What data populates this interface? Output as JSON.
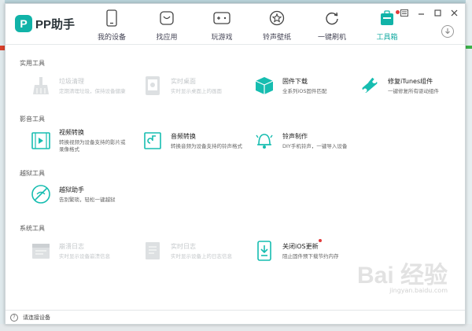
{
  "app": {
    "logo_mark": "P",
    "title": "PP助手"
  },
  "nav": [
    {
      "id": "my-device",
      "label": "我的设备",
      "icon": "phone-icon"
    },
    {
      "id": "find-apps",
      "label": "找应用",
      "icon": "app-bag-icon"
    },
    {
      "id": "games",
      "label": "玩游戏",
      "icon": "gamepad-icon"
    },
    {
      "id": "wallpaper",
      "label": "铃声壁纸",
      "icon": "star-icon"
    },
    {
      "id": "flash",
      "label": "一键刷机",
      "icon": "refresh-icon"
    },
    {
      "id": "toolbox",
      "label": "工具箱",
      "icon": "toolbox-icon",
      "active": true,
      "badge": true
    }
  ],
  "window_controls": [
    "settings-icon",
    "minimize-icon",
    "maximize-icon",
    "close-icon"
  ],
  "sections": [
    {
      "title": "实用工具",
      "tools": [
        {
          "name": "垃圾清理",
          "desc": [
            "定期清理垃圾，保持设备健康"
          ],
          "icon": "broom-icon",
          "disabled": true
        },
        {
          "name": "实时桌面",
          "desc": [
            "实时显示桌面上的画面"
          ],
          "icon": "phone-screen-icon",
          "disabled": true
        },
        {
          "name": "固件下载",
          "desc": [
            "全系列iOS固件匹配"
          ],
          "icon": "firmware-box-icon",
          "disabled": false
        },
        {
          "name": "修复iTunes组件",
          "desc": [
            "一键修复所有驱动组件"
          ],
          "icon": "wrench-icon",
          "disabled": false
        }
      ]
    },
    {
      "title": "影音工具",
      "tools": [
        {
          "name": "视频转换",
          "desc": [
            "转换视频为设备支持的影片或",
            "录像格式"
          ],
          "icon": "video-icon",
          "disabled": false
        },
        {
          "name": "音频转换",
          "desc": [
            "转换音频为设备支持的铃声格式"
          ],
          "icon": "audio-icon",
          "disabled": false
        },
        {
          "name": "铃声制作",
          "desc": [
            "DIY手机铃声，一键导入设备"
          ],
          "icon": "bell-icon",
          "disabled": false
        }
      ]
    },
    {
      "title": "越狱工具",
      "tools": [
        {
          "name": "越狱助手",
          "desc": [
            "告别繁琐，轻松一键越狱"
          ],
          "icon": "jailbreak-icon",
          "disabled": false
        }
      ]
    },
    {
      "title": "系统工具",
      "tools": [
        {
          "name": "崩溃日志",
          "desc": [
            "实时显示设备崩溃信息"
          ],
          "icon": "crash-log-icon",
          "disabled": true
        },
        {
          "name": "实时日志",
          "desc": [
            "实时显示设备上的日志信息"
          ],
          "icon": "realtime-log-icon",
          "disabled": true
        },
        {
          "name": "关闭iOS更新",
          "desc": [
            "阻止固件预下载节约内存"
          ],
          "icon": "block-update-icon",
          "disabled": false,
          "badge": true
        }
      ]
    }
  ],
  "status": {
    "help_icon": "?",
    "text": "请连接设备"
  },
  "watermark": {
    "main": "Bai 经验",
    "sub": "jingyan.baidu.com"
  },
  "colors": {
    "accent": "#11b3a8",
    "badge": "#e23b3b",
    "disabled": "#c3c7ca"
  }
}
